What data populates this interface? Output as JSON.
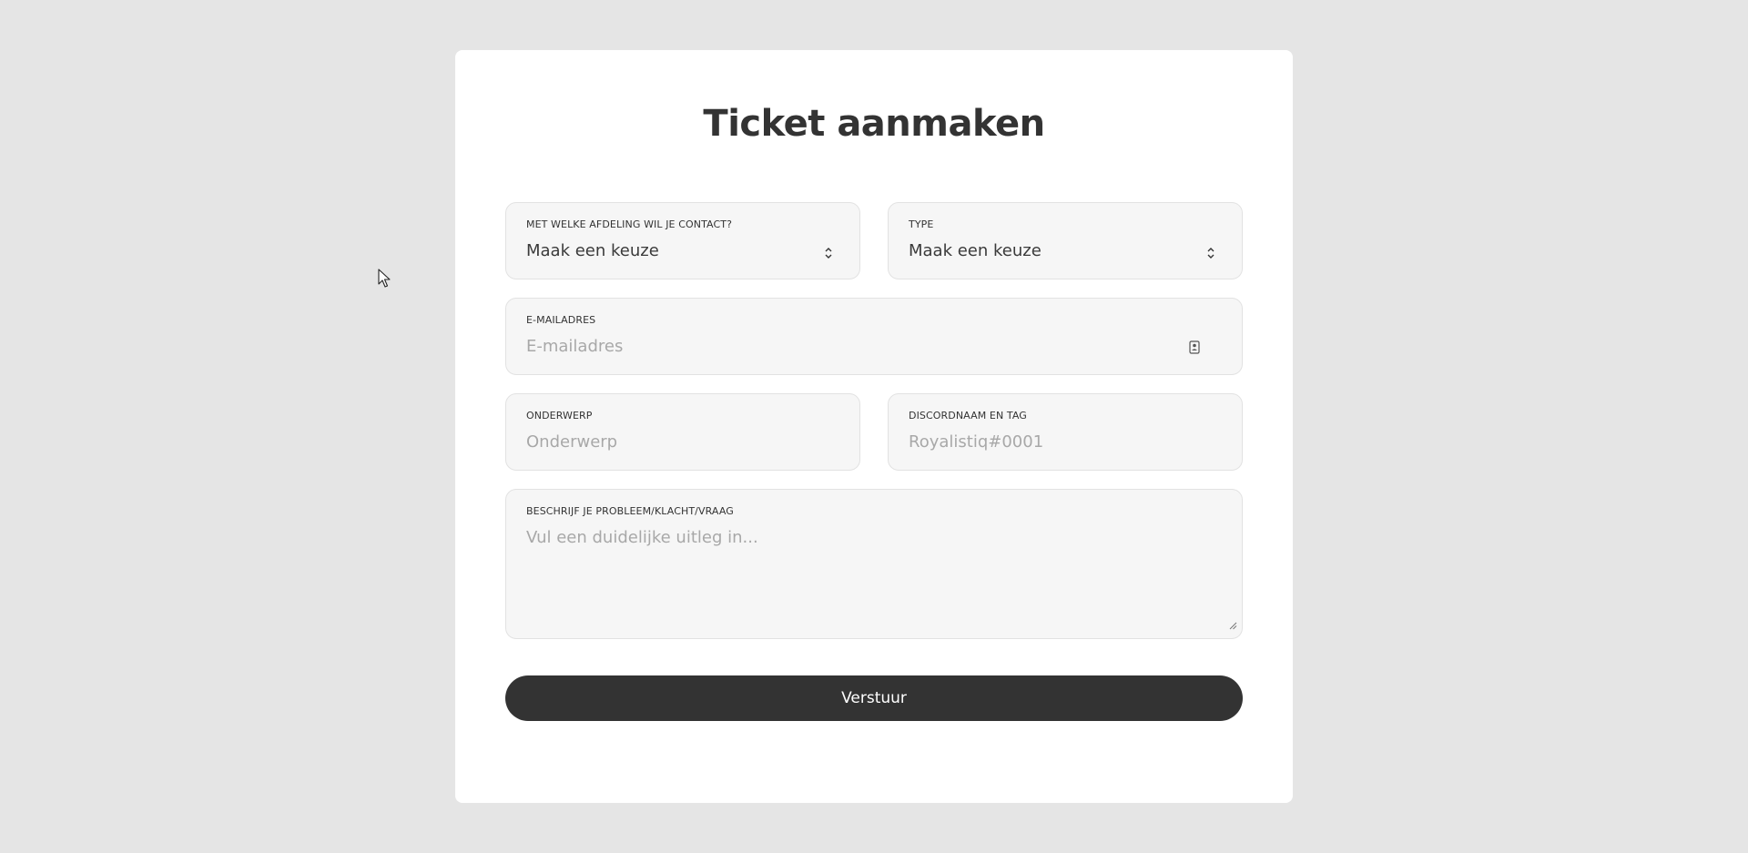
{
  "form": {
    "title": "Ticket aanmaken",
    "department": {
      "label": "Met welke afdeling wil je contact?",
      "value": "Maak een keuze"
    },
    "type": {
      "label": "Type",
      "value": "Maak een keuze"
    },
    "email": {
      "label": "E-mailadres",
      "placeholder": "E-mailadres"
    },
    "subject": {
      "label": "Onderwerp",
      "placeholder": "Onderwerp"
    },
    "discord": {
      "label": "Discordnaam en tag",
      "placeholder": "Royalistiq#0001"
    },
    "description": {
      "label": "Beschrijf je probleem/klacht/vraag",
      "placeholder": "Vul een duidelijke uitleg in..."
    },
    "submit_label": "Verstuur"
  },
  "icons": {
    "select_arrows": "chevron-up-down-icon",
    "email_autofill": "contact-card-icon",
    "textarea_resize": "resize-grip-icon",
    "mouse": "mouse-cursor-icon"
  },
  "colors": {
    "page_background": "#e5e5e5",
    "card_background": "#ffffff",
    "field_background": "#f6f6f6",
    "text": "#333333",
    "placeholder": "#a8a8a8",
    "button_background": "#333333",
    "button_text": "#ffffff"
  }
}
